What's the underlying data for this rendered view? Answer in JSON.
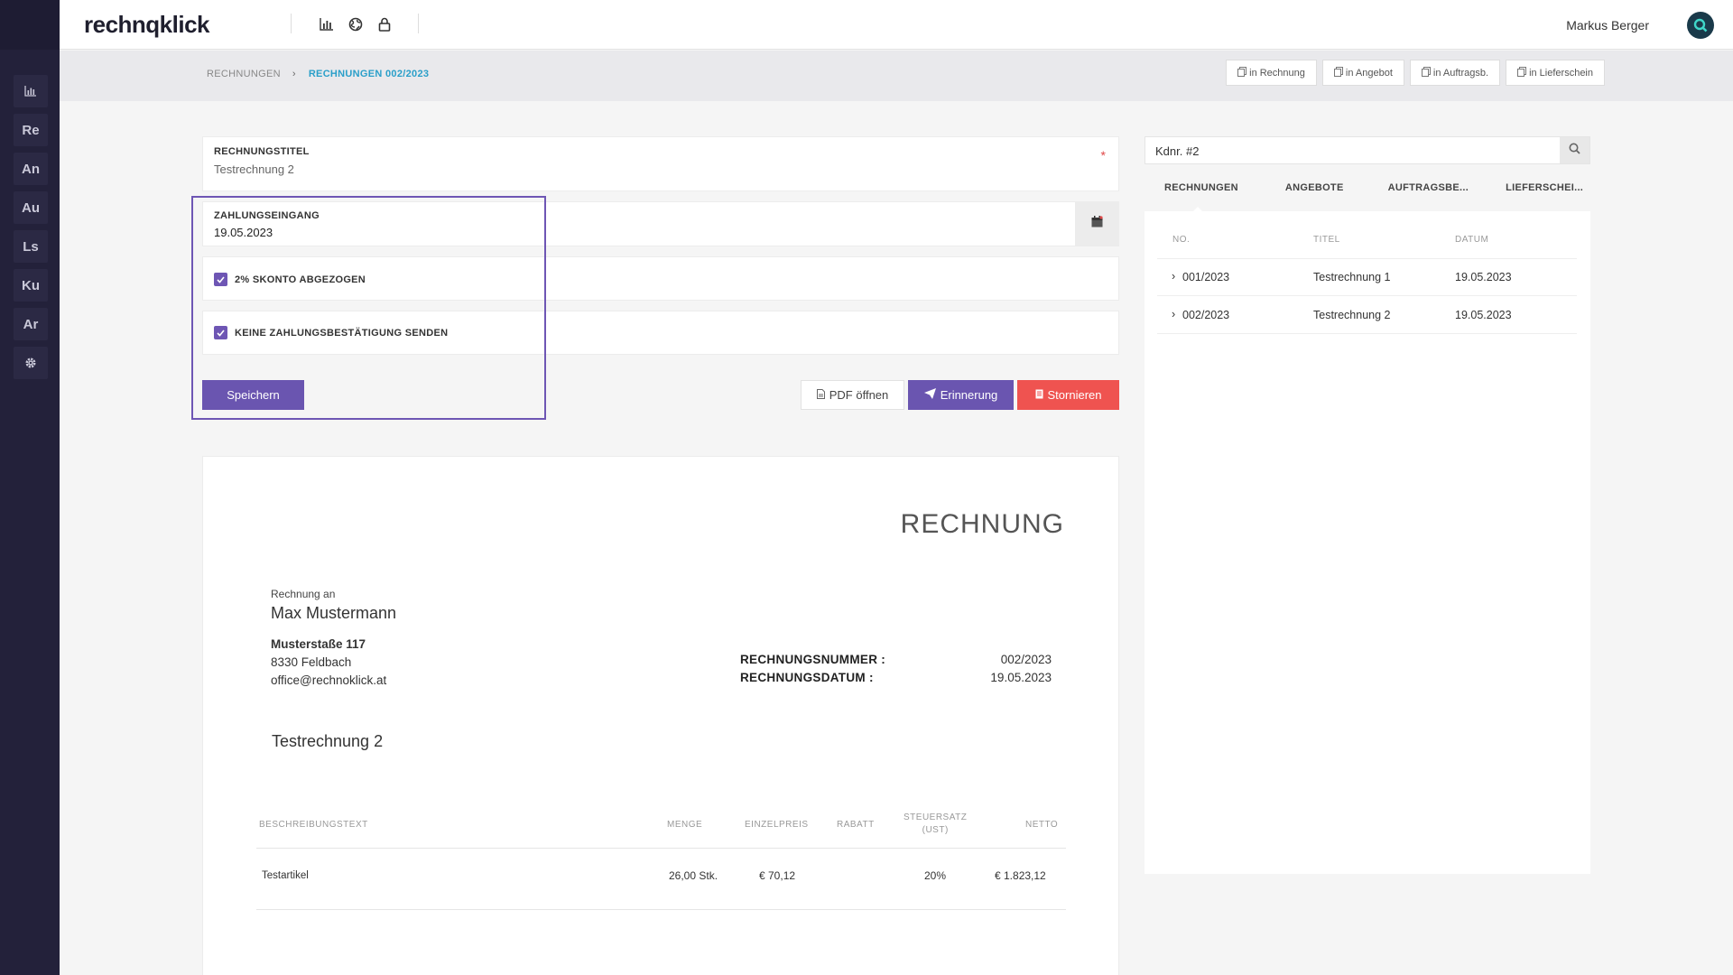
{
  "app": {
    "logo": "rechnqklick"
  },
  "sidebar": {
    "items": [
      {
        "label": "",
        "icon": "chart-icon"
      },
      {
        "label": "Re"
      },
      {
        "label": "An"
      },
      {
        "label": "Au"
      },
      {
        "label": "Ls"
      },
      {
        "label": "Ku"
      },
      {
        "label": "Ar"
      },
      {
        "label": "",
        "icon": "gear-icon"
      }
    ]
  },
  "topbar": {
    "user_name": "Markus Berger"
  },
  "breadcrumb": {
    "root": "RECHNUNGEN",
    "separator": "›",
    "current": "RECHNUNGEN 002/2023"
  },
  "convert": {
    "to_invoice": "in Rechnung",
    "to_offer": "in Angebot",
    "to_order": "in Auftragsb.",
    "to_delivery": "in Lieferschein"
  },
  "form": {
    "title_label": "RECHNUNGSTITEL",
    "title_value": "Testrechnung 2",
    "required_mark": "*",
    "payment_label": "ZAHLUNGSEINGANG",
    "payment_value": "19.05.2023",
    "skonto_label": "2% SKONTO ABGEZOGEN",
    "no_confirm_label": "KEINE ZAHLUNGSBESTÄTIGUNG SENDEN",
    "save": "Speichern",
    "pdf": "PDF öffnen",
    "reminder": "Erinnerung",
    "cancel": "Stornieren"
  },
  "invoice": {
    "heading": "RECHNUNG",
    "to_label": "Rechnung an",
    "customer_name": "Max Mustermann",
    "street": "Musterstaße 117",
    "city": "8330 Feldbach",
    "email": "office@rechnoklick.at",
    "number_label": "RECHNUNGSNUMMER :",
    "number_value": "002/2023",
    "date_label": "RECHNUNGSDATUM :",
    "date_value": "19.05.2023",
    "subject": "Testrechnung 2",
    "columns": {
      "desc": "BESCHREIBUNGSTEXT",
      "qty": "MENGE",
      "unit_price": "EINZELPREIS",
      "discount": "RABATT",
      "tax_1": "STEUERSATZ",
      "tax_2": "(UST)",
      "net": "NETTO"
    },
    "rows": [
      {
        "desc": "Testartikel",
        "qty": "26,00 Stk.",
        "unit_price": "€ 70,12",
        "discount": "",
        "tax": "20%",
        "net": "€ 1.823,12"
      }
    ]
  },
  "right": {
    "search_value": "Kdnr. #2",
    "tabs": [
      "RECHNUNGEN",
      "ANGEBOTE",
      "AUFTRAGSBE...",
      "LIEFERSCHEI..."
    ],
    "columns": {
      "no": "NO.",
      "title": "TITEL",
      "date": "DATUM"
    },
    "rows": [
      {
        "no": "001/2023",
        "title": "Testrechnung 1",
        "date": "19.05.2023"
      },
      {
        "no": "002/2023",
        "title": "Testrechnung 2",
        "date": "19.05.2023"
      }
    ]
  },
  "colors": {
    "accent": "#6a55b0",
    "danger": "#ef5350",
    "link": "#2a9fc9",
    "sidebar": "#23213a"
  }
}
